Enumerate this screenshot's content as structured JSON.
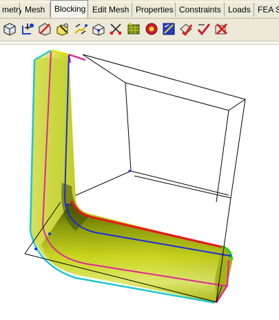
{
  "menu": {
    "tabs": [
      {
        "label": "metry"
      },
      {
        "label": "Mesh"
      },
      {
        "label": "Blocking",
        "active": true
      },
      {
        "label": "Edit Mesh"
      },
      {
        "label": "Properties"
      },
      {
        "label": "Constraints"
      },
      {
        "label": "Loads"
      },
      {
        "label": "FEA S"
      }
    ]
  },
  "toolbar": {
    "icons": [
      "create-block-icon",
      "split-block-icon",
      "merge-vertices-icon",
      "edit-block-icon",
      "associate-icon",
      "move-vertex-icon",
      "transform-blocks-icon",
      "edit-edge-icon",
      "pre-mesh-params-icon",
      "pre-mesh-quality-icon",
      "pre-mesh-smooth-icon",
      "check-blocks-icon",
      "delete-block-icon"
    ]
  },
  "colors": {
    "pipe_fill": "#c6d31c",
    "pipe_highlight": "#e6ee8a",
    "pipe_shadow": "#3d4a00",
    "edge_red": "#e8191c",
    "edge_blue": "#1c2ae0",
    "edge_magenta": "#e0239a",
    "edge_cyan": "#21c7d0",
    "edge_green": "#19d219",
    "block_lines": "#000000"
  }
}
